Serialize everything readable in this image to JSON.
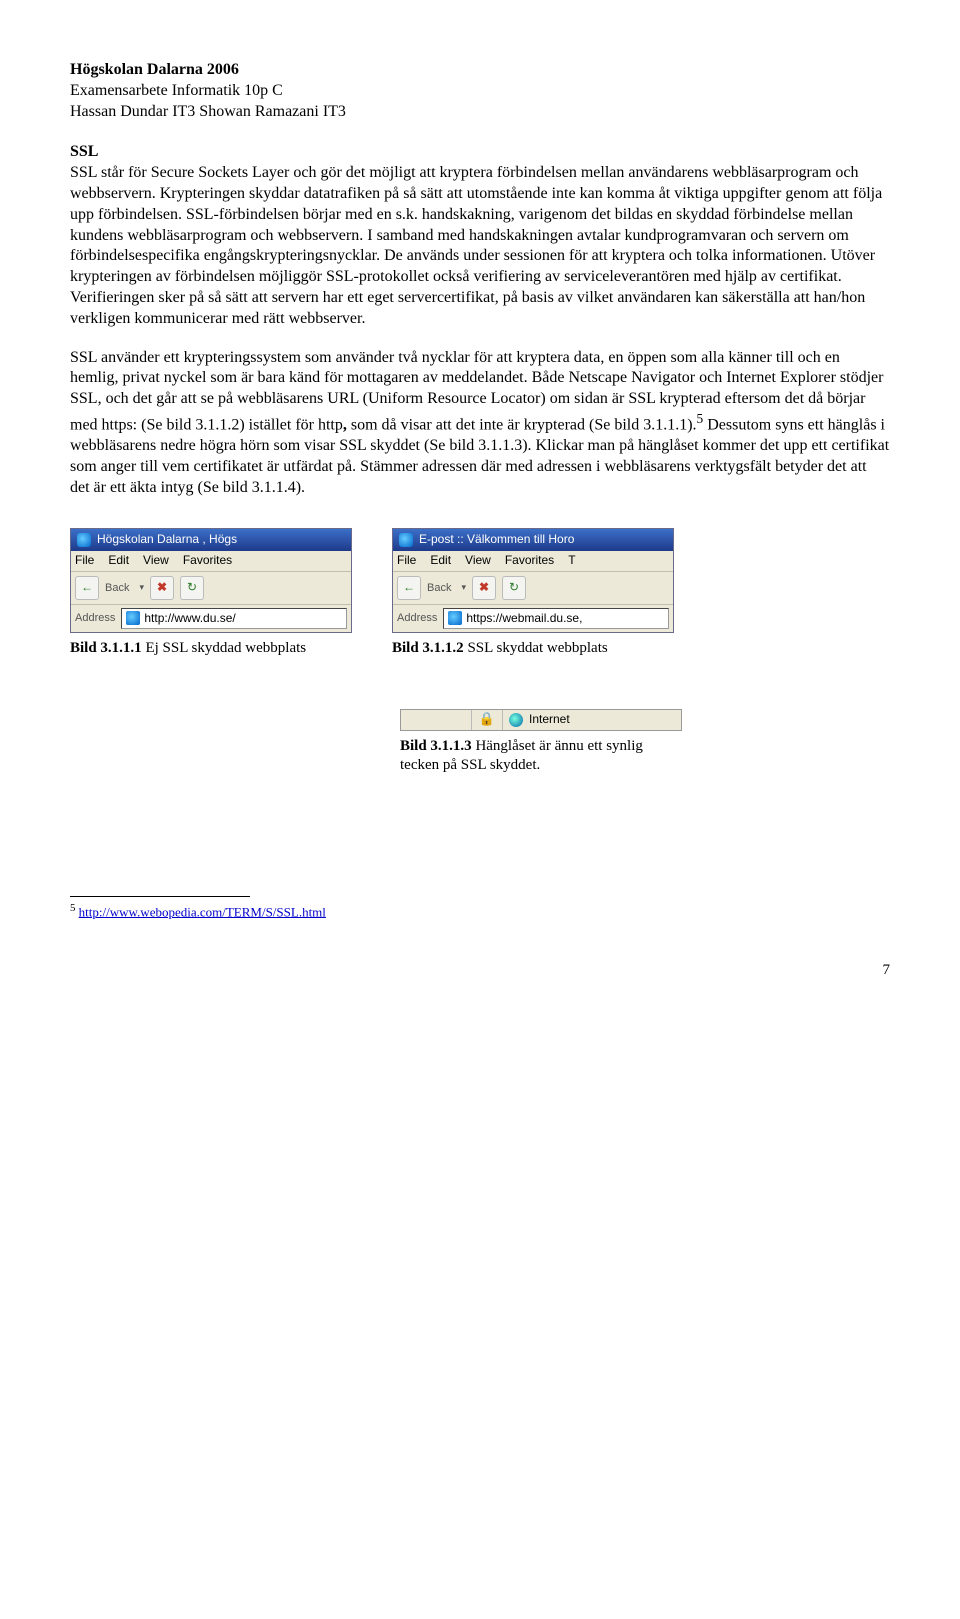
{
  "header": {
    "line1": "Högskolan Dalarna 2006",
    "line2": "Examensarbete Informatik 10p C",
    "line3": "Hassan Dundar IT3 Showan Ramazani IT3"
  },
  "section_title": "SSL",
  "para1": "SSL står för Secure Sockets Layer och gör det möjligt att kryptera förbindelsen mellan användarens webbläsarprogram och webbservern. Krypteringen skyddar datatrafiken på så sätt att utomstående inte kan komma åt viktiga uppgifter genom att följa upp förbindelsen. SSL-förbindelsen börjar med en s.k. handskakning, varigenom det bildas en skyddad förbindelse mellan kundens webbläsarprogram och webbservern. I samband med handskakningen avtalar kundprogramvaran och servern om förbindelsespecifika engångskrypteringsnycklar. De används under sessionen för att kryptera och tolka informationen. Utöver krypteringen av förbindelsen möjliggör SSL-protokollet också verifiering av serviceleverantören med hjälp av certifikat. Verifieringen sker på så sätt att servern har ett eget servercertifikat, på basis av vilket användaren kan säkerställa att han/hon verkligen kommunicerar med rätt webbserver.",
  "para2_a": "SSL använder ett krypteringssystem som använder två nycklar för att kryptera data, en öppen som alla känner till och en hemlig, privat nyckel som är bara känd för mottagaren av meddelandet. Både Netscape Navigator och Internet Explorer stödjer SSL, och det går att se på webbläsarens URL (Uniform Resource Locator) om sidan är SSL krypterad eftersom det då börjar med https: (Se bild 3.1.1.2) istället för http",
  "para2_b": " som då visar att det inte är krypterad (Se bild 3.1.1.1).",
  "para2_c": " Dessutom syns ett hänglås i webbläsarens nedre högra hörn som visar SSL skyddet (Se bild 3.1.1.3). Klickar man på hänglåset kommer det upp ett certifikat som anger till vem certifikatet är utfärdat på. Stämmer adressen där med adressen i webbläsarens verktygsfält betyder det att det är ett äkta intyg (Se bild 3.1.1.4).",
  "sup5": "5",
  "fig1": {
    "title": "Högskolan Dalarna , Högs",
    "menu": {
      "file": "File",
      "edit": "Edit",
      "view": "View",
      "fav": "Favorites"
    },
    "back": "Back",
    "addr_label": "Address",
    "url": "http://www.du.se/",
    "caption_b": "Bild 3.1.1.1",
    "caption_t": " Ej SSL skyddad webbplats"
  },
  "fig2": {
    "title": "E-post :: Välkommen till Horo",
    "menu": {
      "file": "File",
      "edit": "Edit",
      "view": "View",
      "fav": "Favorites",
      "t": "T"
    },
    "back": "Back",
    "addr_label": "Address",
    "url": "https://webmail.du.se,",
    "caption_b": "Bild 3.1.1.2",
    "caption_t": " SSL skyddat webbplats"
  },
  "fig3": {
    "zone": "Internet",
    "caption_b": "Bild 3.1.1.3",
    "caption_t": " Hänglåset är ännu ett synlig tecken på SSL skyddet."
  },
  "footnote": {
    "num": "5",
    "url": "http://www.webopedia.com/TERM/S/SSL.html"
  },
  "page_number": "7"
}
